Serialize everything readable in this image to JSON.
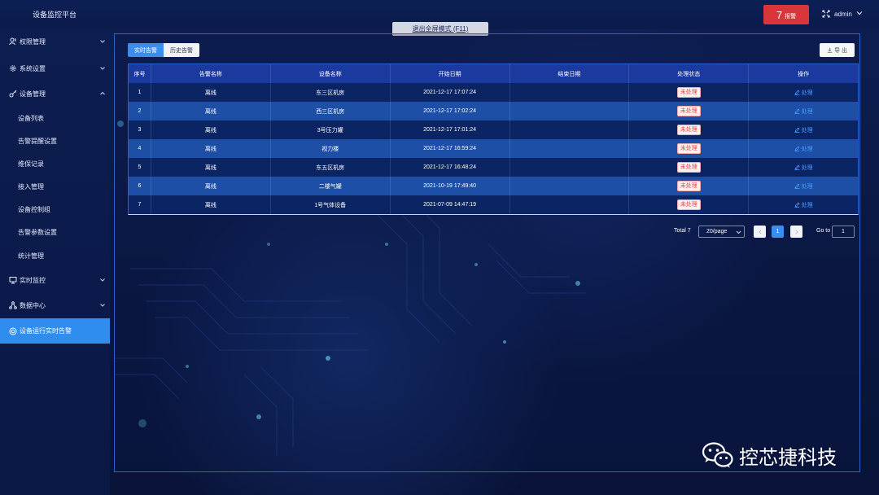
{
  "header": {
    "title": "设备监控平台",
    "alarm_count": "7",
    "alarm_label": "报警",
    "user": "admin",
    "exit_fullscreen": "退出全屏模式 (F11)"
  },
  "sidebar": {
    "items": [
      {
        "label": "权限管理",
        "icon": "users-icon"
      },
      {
        "label": "系统设置",
        "icon": "gear-icon"
      },
      {
        "label": "设备管理",
        "icon": "key-icon"
      },
      {
        "label": "设备列表"
      },
      {
        "label": "告警提醒设置"
      },
      {
        "label": "维保记录"
      },
      {
        "label": "接入管理"
      },
      {
        "label": "设备控制组"
      },
      {
        "label": "告警参数设置"
      },
      {
        "label": "统计管理"
      },
      {
        "label": "实时监控",
        "icon": "monitor-icon"
      },
      {
        "label": "数据中心",
        "icon": "network-icon"
      },
      {
        "label": "设备运行实时告警",
        "icon": "alert-circle-icon"
      }
    ]
  },
  "tabs": [
    "实时告警",
    "历史告警"
  ],
  "export_label": "导 出",
  "table": {
    "columns": [
      "序号",
      "告警名称",
      "设备名称",
      "开始日期",
      "结束日期",
      "处理状态",
      "操作"
    ],
    "rows": [
      {
        "no": "1",
        "alarm": "离线",
        "device": "东三区机房",
        "start": "2021-12-17 17:07:24",
        "end": "",
        "status": "未处理",
        "action": "处理"
      },
      {
        "no": "2",
        "alarm": "离线",
        "device": "西三区机房",
        "start": "2021-12-17 17:02:24",
        "end": "",
        "status": "未处理",
        "action": "处理"
      },
      {
        "no": "3",
        "alarm": "离线",
        "device": "3号压力罐",
        "start": "2021-12-17 17:01:24",
        "end": "",
        "status": "未处理",
        "action": "处理"
      },
      {
        "no": "4",
        "alarm": "离线",
        "device": "视力楼",
        "start": "2021-12-17 16:59:24",
        "end": "",
        "status": "未处理",
        "action": "处理"
      },
      {
        "no": "5",
        "alarm": "离线",
        "device": "东五区机房",
        "start": "2021-12-17 16:48:24",
        "end": "",
        "status": "未处理",
        "action": "处理"
      },
      {
        "no": "6",
        "alarm": "离线",
        "device": "二楼气罐",
        "start": "2021-10-19 17:49:40",
        "end": "",
        "status": "未处理",
        "action": "处理"
      },
      {
        "no": "7",
        "alarm": "离线",
        "device": "1号气体设备",
        "start": "2021-07-09 14:47:19",
        "end": "",
        "status": "未处理",
        "action": "处理"
      }
    ]
  },
  "pagination": {
    "total": "Total 7",
    "page_size": "20/page",
    "current_page": "1",
    "goto_label": "Go to",
    "goto_value": "1"
  },
  "watermark": "控芯捷科技",
  "colors": {
    "accent": "#3a8ef0",
    "alarm": "#d8363a",
    "row_odd": "#0b2464",
    "row_even": "#1c4fa5"
  }
}
